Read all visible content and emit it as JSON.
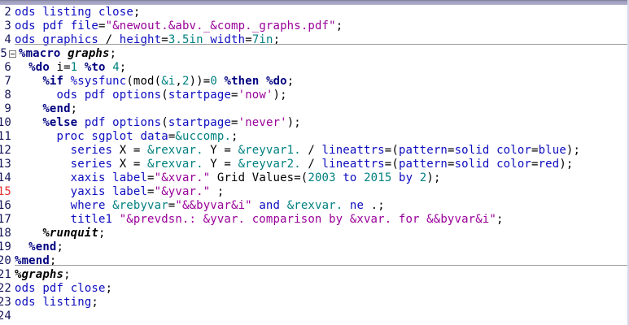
{
  "editor": {
    "description": "SAS Enhanced Editor code pane showing a SAS macro program",
    "colors": {
      "background": "#ffffff",
      "keyword_blue": "#0d0dc0",
      "macro_keyword_navy": "#000080",
      "string_purple": "#990099",
      "number_and_macrovar_teal": "#008080",
      "plain_black": "#000000",
      "line_number": "#14145a",
      "line_number_alert_red": "#e03030",
      "section_divider_gray": "#9b9b9b",
      "top_strip_lavender": "#a7a6c7"
    },
    "icons": {
      "fold_icon": "collapse-minus-box"
    },
    "lines": [
      {
        "num": "2",
        "tokens": [
          [
            "k",
            "ods"
          ],
          [
            "p",
            " "
          ],
          [
            "k",
            "listing"
          ],
          [
            "p",
            " "
          ],
          [
            "k",
            "close"
          ],
          [
            "p",
            ";"
          ]
        ]
      },
      {
        "num": "3",
        "tokens": [
          [
            "k",
            "ods"
          ],
          [
            "p",
            " "
          ],
          [
            "k",
            "pdf"
          ],
          [
            "p",
            " "
          ],
          [
            "k",
            "file"
          ],
          [
            "p",
            "="
          ],
          [
            "s",
            "\"&newout.&abv._&comp._graphs.pdf\""
          ],
          [
            "p",
            ";"
          ]
        ]
      },
      {
        "num": "4",
        "divider": true,
        "tokens": [
          [
            "k",
            "ods"
          ],
          [
            "p",
            " "
          ],
          [
            "k",
            "graphics"
          ],
          [
            "p",
            " / "
          ],
          [
            "k",
            "height"
          ],
          [
            "p",
            "="
          ],
          [
            "n",
            "3.5in"
          ],
          [
            "p",
            " "
          ],
          [
            "k",
            "width"
          ],
          [
            "p",
            "="
          ],
          [
            "n",
            "7in"
          ],
          [
            "p",
            ";"
          ]
        ]
      },
      {
        "num": "5",
        "fold": true,
        "tokens": [
          [
            "m",
            "%macro"
          ],
          [
            "p",
            " "
          ],
          [
            "u",
            "graphs"
          ],
          [
            "p",
            ";"
          ]
        ]
      },
      {
        "num": "6",
        "tokens": [
          [
            "p",
            "  "
          ],
          [
            "m",
            "%do"
          ],
          [
            "p",
            " i="
          ],
          [
            "n",
            "1"
          ],
          [
            "p",
            " "
          ],
          [
            "m",
            "%to"
          ],
          [
            "p",
            " "
          ],
          [
            "n",
            "4"
          ],
          [
            "p",
            ";"
          ]
        ]
      },
      {
        "num": "7",
        "tokens": [
          [
            "p",
            "    "
          ],
          [
            "m",
            "%if"
          ],
          [
            "p",
            " "
          ],
          [
            "k",
            "%sysfunc"
          ],
          [
            "p",
            "(mod("
          ],
          [
            "n",
            "&i"
          ],
          [
            "p",
            ","
          ],
          [
            "n",
            "2"
          ],
          [
            "p",
            "))="
          ],
          [
            "n",
            "0"
          ],
          [
            "p",
            " "
          ],
          [
            "m",
            "%then"
          ],
          [
            "p",
            " "
          ],
          [
            "m",
            "%do"
          ],
          [
            "p",
            ";"
          ]
        ]
      },
      {
        "num": "8",
        "tokens": [
          [
            "p",
            "      "
          ],
          [
            "k",
            "ods"
          ],
          [
            "p",
            " "
          ],
          [
            "k",
            "pdf"
          ],
          [
            "p",
            " "
          ],
          [
            "k",
            "options"
          ],
          [
            "p",
            "("
          ],
          [
            "k",
            "startpage"
          ],
          [
            "p",
            "="
          ],
          [
            "s",
            "'now'"
          ],
          [
            "p",
            ");"
          ]
        ]
      },
      {
        "num": "9",
        "tokens": [
          [
            "p",
            "    "
          ],
          [
            "m",
            "%end"
          ],
          [
            "p",
            ";"
          ]
        ]
      },
      {
        "num": "10",
        "tokens": [
          [
            "p",
            "    "
          ],
          [
            "m",
            "%else"
          ],
          [
            "p",
            " "
          ],
          [
            "k",
            "pdf"
          ],
          [
            "p",
            " "
          ],
          [
            "k",
            "options"
          ],
          [
            "p",
            "("
          ],
          [
            "k",
            "startpage"
          ],
          [
            "p",
            "="
          ],
          [
            "s",
            "'never'"
          ],
          [
            "p",
            ");"
          ]
        ]
      },
      {
        "num": "11",
        "tokens": [
          [
            "p",
            "      "
          ],
          [
            "k",
            "proc"
          ],
          [
            "p",
            " "
          ],
          [
            "k",
            "sgplot"
          ],
          [
            "p",
            " "
          ],
          [
            "k",
            "data"
          ],
          [
            "p",
            "="
          ],
          [
            "n",
            "&uccomp."
          ],
          [
            "p",
            ";"
          ]
        ]
      },
      {
        "num": "12",
        "tokens": [
          [
            "p",
            "        "
          ],
          [
            "k",
            "series"
          ],
          [
            "p",
            " X = "
          ],
          [
            "n",
            "&rexvar."
          ],
          [
            "p",
            " Y = "
          ],
          [
            "n",
            "&reyvar1."
          ],
          [
            "p",
            " / "
          ],
          [
            "k",
            "lineattrs"
          ],
          [
            "p",
            "=("
          ],
          [
            "k",
            "pattern"
          ],
          [
            "p",
            "="
          ],
          [
            "k",
            "solid"
          ],
          [
            "p",
            " "
          ],
          [
            "k",
            "color"
          ],
          [
            "p",
            "="
          ],
          [
            "k",
            "blue"
          ],
          [
            "p",
            ");"
          ]
        ]
      },
      {
        "num": "13",
        "tokens": [
          [
            "p",
            "        "
          ],
          [
            "k",
            "series"
          ],
          [
            "p",
            " X = "
          ],
          [
            "n",
            "&rexvar."
          ],
          [
            "p",
            " Y = "
          ],
          [
            "n",
            "&reyvar2."
          ],
          [
            "p",
            " / "
          ],
          [
            "k",
            "lineattrs"
          ],
          [
            "p",
            "=("
          ],
          [
            "k",
            "pattern"
          ],
          [
            "p",
            "="
          ],
          [
            "k",
            "solid"
          ],
          [
            "p",
            " "
          ],
          [
            "k",
            "color"
          ],
          [
            "p",
            "="
          ],
          [
            "k",
            "red"
          ],
          [
            "p",
            ");"
          ]
        ]
      },
      {
        "num": "14",
        "tokens": [
          [
            "p",
            "        "
          ],
          [
            "k",
            "xaxis"
          ],
          [
            "p",
            " "
          ],
          [
            "k",
            "label"
          ],
          [
            "p",
            "="
          ],
          [
            "s",
            "\"&xvar.\""
          ],
          [
            "p",
            " Grid Values=("
          ],
          [
            "n",
            "2003"
          ],
          [
            "p",
            " "
          ],
          [
            "k",
            "to"
          ],
          [
            "p",
            " "
          ],
          [
            "n",
            "2015"
          ],
          [
            "p",
            " "
          ],
          [
            "k",
            "by"
          ],
          [
            "p",
            " "
          ],
          [
            "n",
            "2"
          ],
          [
            "p",
            ");"
          ]
        ]
      },
      {
        "num": "15",
        "num_red": true,
        "tokens": [
          [
            "p",
            "        "
          ],
          [
            "k",
            "yaxis"
          ],
          [
            "p",
            " "
          ],
          [
            "k",
            "label"
          ],
          [
            "p",
            "="
          ],
          [
            "s",
            "\"&yvar.\""
          ],
          [
            "p",
            " ;"
          ]
        ]
      },
      {
        "num": "16",
        "tokens": [
          [
            "p",
            "        "
          ],
          [
            "k",
            "where"
          ],
          [
            "p",
            " "
          ],
          [
            "n",
            "&rebyvar"
          ],
          [
            "p",
            "="
          ],
          [
            "s",
            "\"&&byvar&i\""
          ],
          [
            "p",
            " "
          ],
          [
            "k",
            "and"
          ],
          [
            "p",
            " "
          ],
          [
            "n",
            "&rexvar."
          ],
          [
            "p",
            " "
          ],
          [
            "k",
            "ne"
          ],
          [
            "p",
            " .;"
          ]
        ]
      },
      {
        "num": "17",
        "tokens": [
          [
            "p",
            "        "
          ],
          [
            "k",
            "title1"
          ],
          [
            "p",
            " "
          ],
          [
            "s",
            "\"&prevdsn.: &yvar. comparison by &xvar. for &&byvar&i\""
          ],
          [
            "p",
            ";"
          ]
        ]
      },
      {
        "num": "18",
        "tokens": [
          [
            "p",
            "    "
          ],
          [
            "u",
            "%runquit"
          ],
          [
            "p",
            ";"
          ]
        ]
      },
      {
        "num": "19",
        "tokens": [
          [
            "p",
            "  "
          ],
          [
            "m",
            "%end"
          ],
          [
            "p",
            ";"
          ]
        ]
      },
      {
        "num": "20",
        "divider": true,
        "tokens": [
          [
            "m",
            "%mend"
          ],
          [
            "p",
            ";"
          ]
        ]
      },
      {
        "num": "21",
        "tokens": [
          [
            "u",
            "%graphs"
          ],
          [
            "p",
            ";"
          ]
        ]
      },
      {
        "num": "22",
        "tokens": [
          [
            "k",
            "ods"
          ],
          [
            "p",
            " "
          ],
          [
            "k",
            "pdf"
          ],
          [
            "p",
            " "
          ],
          [
            "k",
            "close"
          ],
          [
            "p",
            ";"
          ]
        ]
      },
      {
        "num": "23",
        "tokens": [
          [
            "k",
            "ods"
          ],
          [
            "p",
            " "
          ],
          [
            "k",
            "listing"
          ],
          [
            "p",
            ";"
          ]
        ]
      },
      {
        "num": "24",
        "tokens": []
      }
    ]
  }
}
